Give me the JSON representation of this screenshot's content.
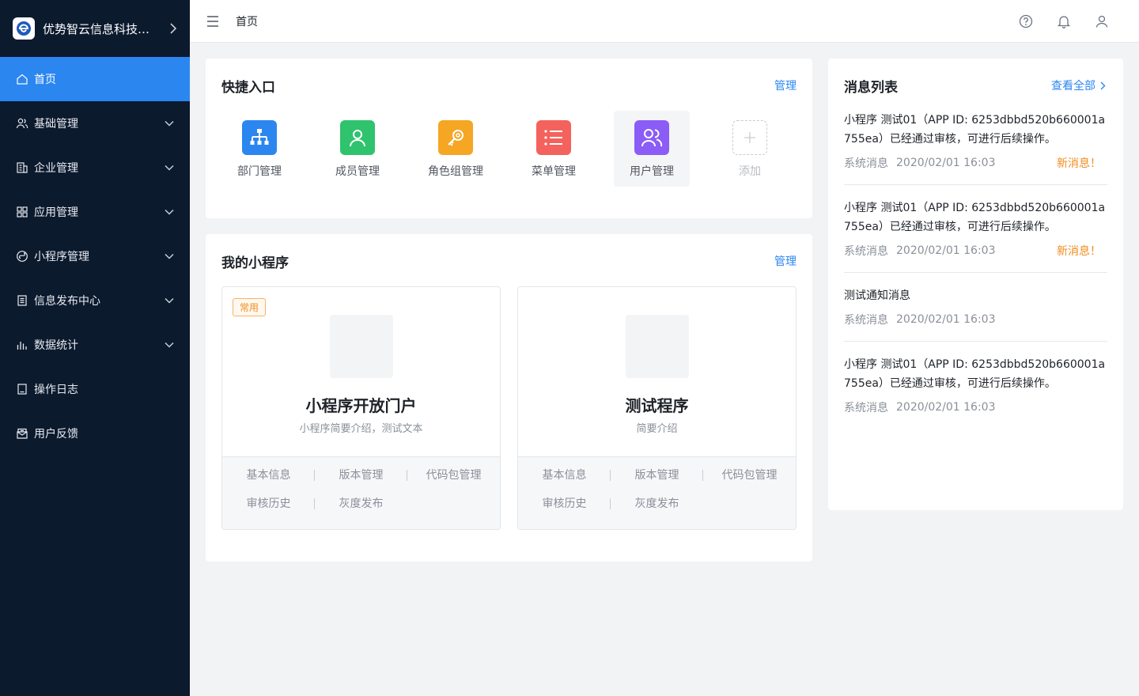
{
  "brand": {
    "name": "优势智云信息科技有限公司"
  },
  "sidebar": {
    "items": [
      {
        "label": "首页",
        "icon": "home-icon",
        "active": true,
        "expandable": false
      },
      {
        "label": "基础管理",
        "icon": "users-icon",
        "expandable": true
      },
      {
        "label": "企业管理",
        "icon": "building-icon",
        "expandable": true
      },
      {
        "label": "应用管理",
        "icon": "grid-icon",
        "expandable": true
      },
      {
        "label": "小程序管理",
        "icon": "miniprogram-icon",
        "expandable": true
      },
      {
        "label": "信息发布中心",
        "icon": "document-icon",
        "expandable": true
      },
      {
        "label": "数据统计",
        "icon": "bar-chart-icon",
        "expandable": true
      },
      {
        "label": "操作日志",
        "icon": "log-icon",
        "expandable": false
      },
      {
        "label": "用户反馈",
        "icon": "feedback-icon",
        "expandable": false
      }
    ]
  },
  "header": {
    "breadcrumb": "首页"
  },
  "quick": {
    "title": "快捷入口",
    "manage": "管理",
    "items": [
      {
        "label": "部门管理",
        "color": "#2b86f0",
        "icon": "org-chart-icon"
      },
      {
        "label": "成员管理",
        "color": "#2fc36d",
        "icon": "person-icon"
      },
      {
        "label": "角色组管理",
        "color": "#f5a623",
        "icon": "key-icon"
      },
      {
        "label": "菜单管理",
        "color": "#f4625d",
        "icon": "list-icon"
      },
      {
        "label": "用户管理",
        "color": "#8b5cf6",
        "icon": "users-icon"
      },
      {
        "label": "添加",
        "icon": "plus-icon"
      }
    ]
  },
  "apps": {
    "title": "我的小程序",
    "manage": "管理",
    "cards": [
      {
        "tag": "常用",
        "name": "小程序开放门户",
        "desc": "小程序简要介绍，测试文本",
        "actions": [
          "基本信息",
          "版本管理",
          "代码包管理",
          "审核历史",
          "灰度发布"
        ]
      },
      {
        "name": "测试程序",
        "desc": "简要介绍",
        "actions": [
          "基本信息",
          "版本管理",
          "代码包管理",
          "审核历史",
          "灰度发布"
        ]
      }
    ]
  },
  "messages": {
    "title": "消息列表",
    "view_all": "查看全部",
    "items": [
      {
        "text": "小程序 测试01（APP ID: 6253dbbd520b660001a755ea）已经通过审核，可进行后续操作。",
        "type": "系统消息",
        "time": "2020/02/01 16:03",
        "new": "新消息！"
      },
      {
        "text": "小程序 测试01（APP ID: 6253dbbd520b660001a755ea）已经通过审核，可进行后续操作。",
        "type": "系统消息",
        "time": "2020/02/01 16:03",
        "new": "新消息！"
      },
      {
        "text": "测试通知消息",
        "type": "系统消息",
        "time": "2020/02/01 16:03"
      },
      {
        "text": "小程序 测试01（APP ID: 6253dbbd520b660001a755ea）已经通过审核，可进行后续操作。",
        "type": "系统消息",
        "time": "2020/02/01 16:03"
      }
    ]
  }
}
